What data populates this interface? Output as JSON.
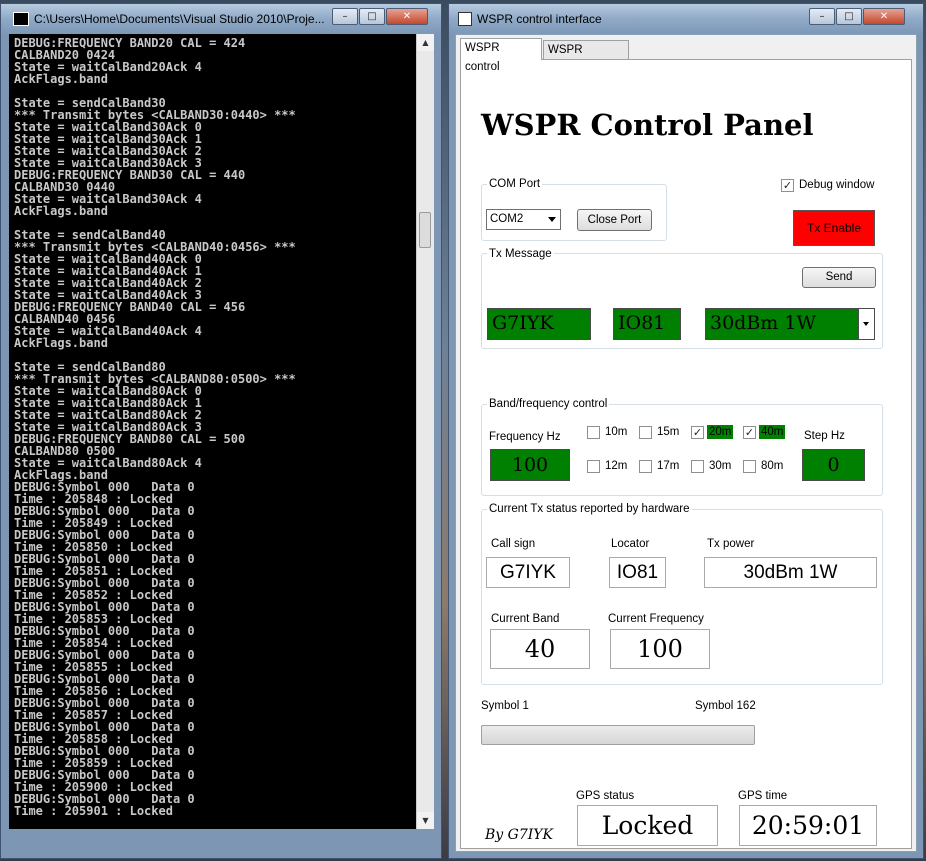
{
  "console": {
    "title": "C:\\Users\\Home\\Documents\\Visual Studio 2010\\Proje...",
    "lines": [
      "DEBUG:FREQUENCY BAND20 CAL = 424",
      "CALBAND20 0424",
      "State = waitCalBand20Ack 4",
      "AckFlags.band",
      "",
      "State = sendCalBand30",
      "*** Transmit bytes <CALBAND30:0440> ***",
      "State = waitCalBand30Ack 0",
      "State = waitCalBand30Ack 1",
      "State = waitCalBand30Ack 2",
      "State = waitCalBand30Ack 3",
      "DEBUG:FREQUENCY BAND30 CAL = 440",
      "CALBAND30 0440",
      "State = waitCalBand30Ack 4",
      "AckFlags.band",
      "",
      "State = sendCalBand40",
      "*** Transmit bytes <CALBAND40:0456> ***",
      "State = waitCalBand40Ack 0",
      "State = waitCalBand40Ack 1",
      "State = waitCalBand40Ack 2",
      "State = waitCalBand40Ack 3",
      "DEBUG:FREQUENCY BAND40 CAL = 456",
      "CALBAND40 0456",
      "State = waitCalBand40Ack 4",
      "AckFlags.band",
      "",
      "State = sendCalBand80",
      "*** Transmit bytes <CALBAND80:0500> ***",
      "State = waitCalBand80Ack 0",
      "State = waitCalBand80Ack 1",
      "State = waitCalBand80Ack 2",
      "State = waitCalBand80Ack 3",
      "DEBUG:FREQUENCY BAND80 CAL = 500",
      "CALBAND80 0500",
      "State = waitCalBand80Ack 4",
      "AckFlags.band",
      "DEBUG:Symbol 000   Data 0",
      "Time : 205848 : Locked",
      "DEBUG:Symbol 000   Data 0",
      "Time : 205849 : Locked",
      "DEBUG:Symbol 000   Data 0",
      "Time : 205850 : Locked",
      "DEBUG:Symbol 000   Data 0",
      "Time : 205851 : Locked",
      "DEBUG:Symbol 000   Data 0",
      "Time : 205852 : Locked",
      "DEBUG:Symbol 000   Data 0",
      "Time : 205853 : Locked",
      "DEBUG:Symbol 000   Data 0",
      "Time : 205854 : Locked",
      "DEBUG:Symbol 000   Data 0",
      "Time : 205855 : Locked",
      "DEBUG:Symbol 000   Data 0",
      "Time : 205856 : Locked",
      "DEBUG:Symbol 000   Data 0",
      "Time : 205857 : Locked",
      "DEBUG:Symbol 000   Data 0",
      "Time : 205858 : Locked",
      "DEBUG:Symbol 000   Data 0",
      "Time : 205859 : Locked",
      "DEBUG:Symbol 000   Data 0",
      "Time : 205900 : Locked",
      "DEBUG:Symbol 000   Data 0",
      "Time : 205901 : Locked"
    ]
  },
  "window": {
    "title": "WSPR control interface",
    "minimize": "–",
    "maximize": "□",
    "close": "✕"
  },
  "tabs": [
    "WSPR control",
    "WSPR calibrate"
  ],
  "panel_title": "WSPR Control Panel",
  "com_port": {
    "label": "COM Port",
    "selected": "COM2",
    "close_button": "Close Port"
  },
  "debug_window": {
    "label": "Debug window",
    "checked": true,
    "check_mark": "✓"
  },
  "tx_enable": {
    "label": "Tx Enable",
    "color": "#ff0000"
  },
  "tx_message": {
    "label": "Tx Message",
    "send_button": "Send",
    "callsign": "G7IYK",
    "locator": "IO81",
    "power": "30dBm 1W"
  },
  "band_control": {
    "label": "Band/frequency control",
    "frequency_label": "Frequency Hz",
    "frequency_value": "100",
    "step_label": "Step Hz",
    "step_value": "0",
    "check_mark": "✓",
    "bands": [
      {
        "label": "10m",
        "checked": false
      },
      {
        "label": "15m",
        "checked": false
      },
      {
        "label": "20m",
        "checked": true
      },
      {
        "label": "40m",
        "checked": true
      },
      {
        "label": "12m",
        "checked": false
      },
      {
        "label": "17m",
        "checked": false
      },
      {
        "label": "30m",
        "checked": false
      },
      {
        "label": "80m",
        "checked": false
      }
    ],
    "active_color": "#008000"
  },
  "status": {
    "label": "Current Tx status reported by hardware",
    "call_sign_label": "Call sign",
    "call_sign_value": "G7IYK",
    "locator_label": "Locator",
    "locator_value": "IO81",
    "power_label": "Tx power",
    "power_value": "30dBm 1W",
    "band_label": "Current Band",
    "band_value": "40",
    "freq_label": "Current Frequency",
    "freq_value": "100"
  },
  "symbols": {
    "start_label": "Symbol 1",
    "end_label": "Symbol 162",
    "progress": 0
  },
  "gps": {
    "status_label": "GPS status",
    "status_value": "Locked",
    "time_label": "GPS time",
    "time_value": "20:59:01"
  },
  "signature": "By G7IYK"
}
